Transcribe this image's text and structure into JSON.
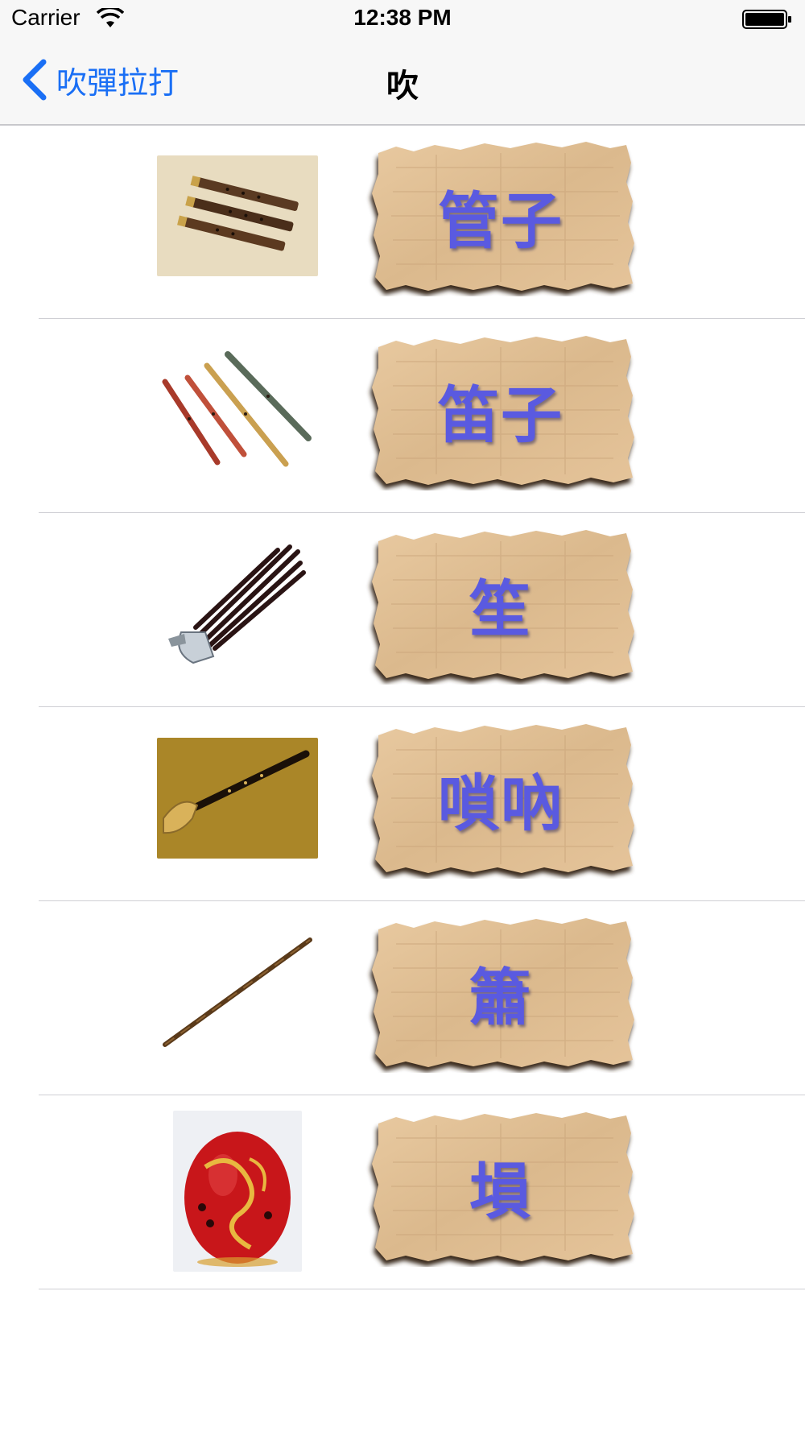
{
  "status_bar": {
    "carrier": "Carrier",
    "time": "12:38 PM",
    "wifi_icon": "wifi-icon",
    "battery_icon": "battery-icon"
  },
  "nav": {
    "back_label": "吹彈拉打",
    "back_icon": "chevron-left-icon",
    "title": "吹",
    "accent_color": "#1a6ff5"
  },
  "list": {
    "label_color": "#5a5ae0",
    "items": [
      {
        "label": "管子",
        "thumbnail": "guanzi-instrument-photo"
      },
      {
        "label": "笛子",
        "thumbnail": "dizi-flutes-photo"
      },
      {
        "label": "笙",
        "thumbnail": "sheng-mouth-organ-photo"
      },
      {
        "label": "嗩吶",
        "thumbnail": "suona-horn-photo"
      },
      {
        "label": "簫",
        "thumbnail": "xiao-flute-photo"
      },
      {
        "label": "塤",
        "thumbnail": "xun-ocarina-photo"
      }
    ]
  }
}
